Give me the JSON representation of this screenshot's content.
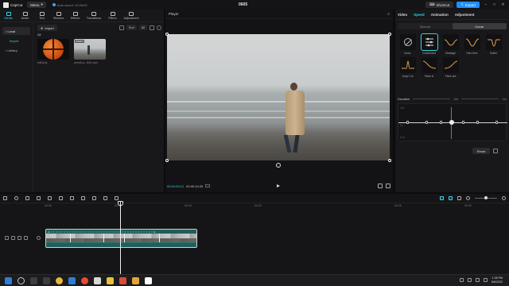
{
  "titlebar": {
    "app_name": "CapCut",
    "menu_label": "Menu",
    "autosave": "Auto saved: 13:28:00",
    "project_title": "0605",
    "shortcut_label": "Shortcut",
    "export_label": "Export"
  },
  "toolbar_tabs": [
    {
      "label": "Media",
      "icon": "media-icon",
      "active": true
    },
    {
      "label": "Audio",
      "icon": "audio-icon"
    },
    {
      "label": "Text",
      "icon": "text-icon"
    },
    {
      "label": "Stickers",
      "icon": "sticker-icon"
    },
    {
      "label": "Effects",
      "icon": "effects-icon"
    },
    {
      "label": "Transitions",
      "icon": "transitions-icon"
    },
    {
      "label": "Filters",
      "icon": "filters-icon"
    },
    {
      "label": "Adjustment",
      "icon": "adjustment-icon"
    }
  ],
  "library_nav": {
    "local": "• Local",
    "import": "Import",
    "library": "• Library"
  },
  "media": {
    "import_label": "Import",
    "sort_label": "Sort",
    "all_label": "All",
    "filter_all": "All",
    "items": [
      {
        "name": "ball.png",
        "added": ""
      },
      {
        "name": "pexels-a...826.mp4",
        "added": "Added"
      }
    ]
  },
  "player": {
    "title": "Player",
    "timecode_current": "00:00:05:12",
    "timecode_total": "00:00:10:25"
  },
  "right_panel": {
    "tabs": [
      {
        "label": "Video"
      },
      {
        "label": "Speed",
        "active": true
      },
      {
        "label": "Animation"
      },
      {
        "label": "Adjustment"
      }
    ],
    "segment": {
      "normal": "Normal",
      "curve": "Curve"
    },
    "presets": [
      {
        "label": "None"
      },
      {
        "label": "Customized",
        "active": true
      },
      {
        "label": "Montage"
      },
      {
        "label": "Hero time"
      },
      {
        "label": "Bullet"
      },
      {
        "label": "Jump Cut"
      },
      {
        "label": "Flash in"
      },
      {
        "label": "Flash out"
      }
    ],
    "duration_label": "Duration",
    "duration_from": "10s",
    "duration_to": "11s",
    "graph_labels": [
      "10x",
      "1x",
      "0.1x"
    ],
    "reset_label": "Reset"
  },
  "timeline": {
    "ruler_labels": [
      "00:05",
      "00:10",
      "00:15",
      "00:20",
      "00:25",
      "00:30"
    ]
  },
  "taskbar": {
    "time": "1:28 PM",
    "date": "6/6/2022"
  }
}
